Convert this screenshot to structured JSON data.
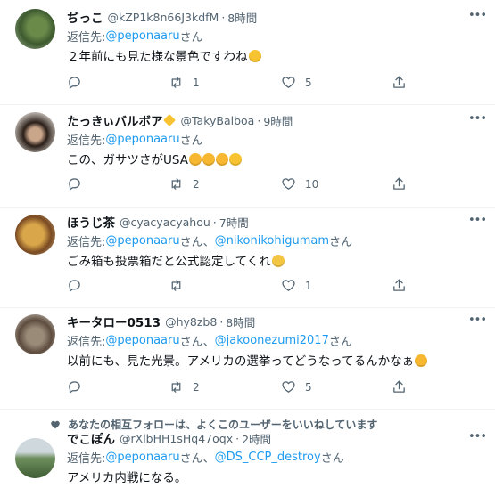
{
  "tweets": [
    {
      "name": "ぢっこ",
      "handle": "@kZP1k8n66J3kdfM",
      "time": "8時間",
      "reply_label": "返信先: ",
      "mentions": [
        "@peponaaru"
      ],
      "suffix": "さん",
      "text": "２年前にも見た様な景色ですわね",
      "emojis": [
        "upside-down-face"
      ],
      "replies": "",
      "retweets": "1",
      "likes": "5"
    },
    {
      "name": "たっきぃバルボア",
      "name_badge": "sparkles",
      "handle": "@TakyBalboa",
      "time": "9時間",
      "reply_label": "返信先: ",
      "mentions": [
        "@peponaaru"
      ],
      "suffix": "さん",
      "text": "この、ガサツさがUSA",
      "emojis": [
        "rolling-on-floor-laughing",
        "rolling-on-floor-laughing",
        "rolling-on-floor-laughing",
        "zany-face"
      ],
      "replies": "",
      "retweets": "2",
      "likes": "10"
    },
    {
      "name": "ほうじ茶",
      "handle": "@cyacyacyahou",
      "time": "7時間",
      "reply_label": "返信先: ",
      "mentions": [
        "@peponaaru",
        "@nikonikohigumam"
      ],
      "suffix": "さん",
      "text": "ごみ箱も投票箱だと公式認定してくれ",
      "emojis": [
        "hugging-face"
      ],
      "replies": "",
      "retweets": "",
      "likes": "1"
    },
    {
      "name": "キータロー0513",
      "handle": "@hy8zb8",
      "time": "8時間",
      "reply_label": "返信先: ",
      "mentions": [
        "@peponaaru",
        "@jakoonezumi2017"
      ],
      "suffix": "さん",
      "text": "以前にも、見た光景。アメリカの選挙ってどうなってるんかなぁ",
      "emojis": [
        "astonished-face"
      ],
      "replies": "",
      "retweets": "2",
      "likes": "5"
    },
    {
      "social_context": "あなたの相互フォローは、よくこのユーザーをいいねしています",
      "name": "でこぽん",
      "handle": "@rXlbHH1sHq47oqx",
      "time": "2時間",
      "reply_label": "返信先: ",
      "mentions": [
        "@peponaaru",
        "@DS_CCP_destroy"
      ],
      "suffix": "さん",
      "text": "アメリカ内戦になる。",
      "emojis": []
    }
  ],
  "more_label": "•••",
  "dot": "·",
  "mention_separator": "、",
  "colors": {
    "accent": "#1d9bf0",
    "muted": "#536471",
    "text": "#0f1419",
    "border": "#eff3f4"
  },
  "icons": {
    "reply": "reply-icon",
    "retweet": "retweet-icon",
    "like": "heart-icon",
    "share": "share-icon",
    "more": "more-icon",
    "social": "heart-icon"
  }
}
